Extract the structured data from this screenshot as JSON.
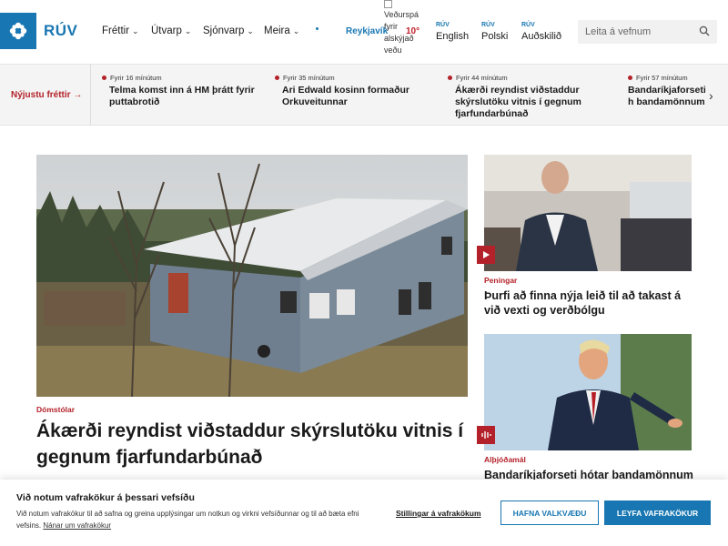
{
  "header": {
    "logo": "RÚV",
    "nav": [
      {
        "label": "Fréttir"
      },
      {
        "label": "Útvarp"
      },
      {
        "label": "Sjónvarp"
      },
      {
        "label": "Meira"
      }
    ],
    "weather": {
      "city": "Reykjavík",
      "image_alt": "Veðurspá fyrir alskýjað veðu",
      "temp": "10°"
    },
    "languages": [
      {
        "tag": "RÚV",
        "name": "English"
      },
      {
        "tag": "RÚV",
        "name": "Polski"
      },
      {
        "tag": "RÚV",
        "name": "Auðskilið"
      }
    ],
    "search": {
      "placeholder": "Leita á vefnum"
    }
  },
  "ticker": {
    "label": "Nýjustu fréttir →",
    "items": [
      {
        "time": "Fyrir 16 mínútum",
        "title": "Telma komst inn á HM þrátt fyrir puttabrotið"
      },
      {
        "time": "Fyrir 35 mínútum",
        "title": "Ari Edwald kosinn formaður Orkuveitunnar"
      },
      {
        "time": "Fyrir 44 mínútum",
        "title": "Ákærði reyndist viðstaddur skýrslutöku vitnis í gegnum fjarfundarbúnað"
      },
      {
        "time": "Fyrir 57 mínútum",
        "title": "Bandaríkjaforseti h bandamönnum"
      }
    ]
  },
  "main_story": {
    "category": "Dómstólar",
    "title": "Ákærði reyndist viðstaddur skýrslutöku vitnis í gegnum fjarfundarbúnað"
  },
  "side_stories": [
    {
      "category": "Peningar",
      "title": "Þurfi að finna nýja leið til að takast á við vexti og verðbólgu",
      "media": "video"
    },
    {
      "category": "Alþjóðamál",
      "title": "Bandaríkjaforseti hótar bandamönnum",
      "media": "audio"
    }
  ],
  "cookie": {
    "title": "Við notum vafrakökur á þessari vefsíðu",
    "text": "Við notum vafrakökur til að safna og greina upplýsingar um notkun og virkni vefsíðunnar og til að bæta efni vefsins.",
    "link": "Nánar um vafrakökur",
    "settings": "Stillingar á vafrakökum",
    "reject": "HAFNA VALKVÆÐU",
    "accept": "LEYFA VAFRAKÖKUR"
  },
  "colors": {
    "brand": "#1877b2",
    "accent_red": "#b3222a"
  }
}
